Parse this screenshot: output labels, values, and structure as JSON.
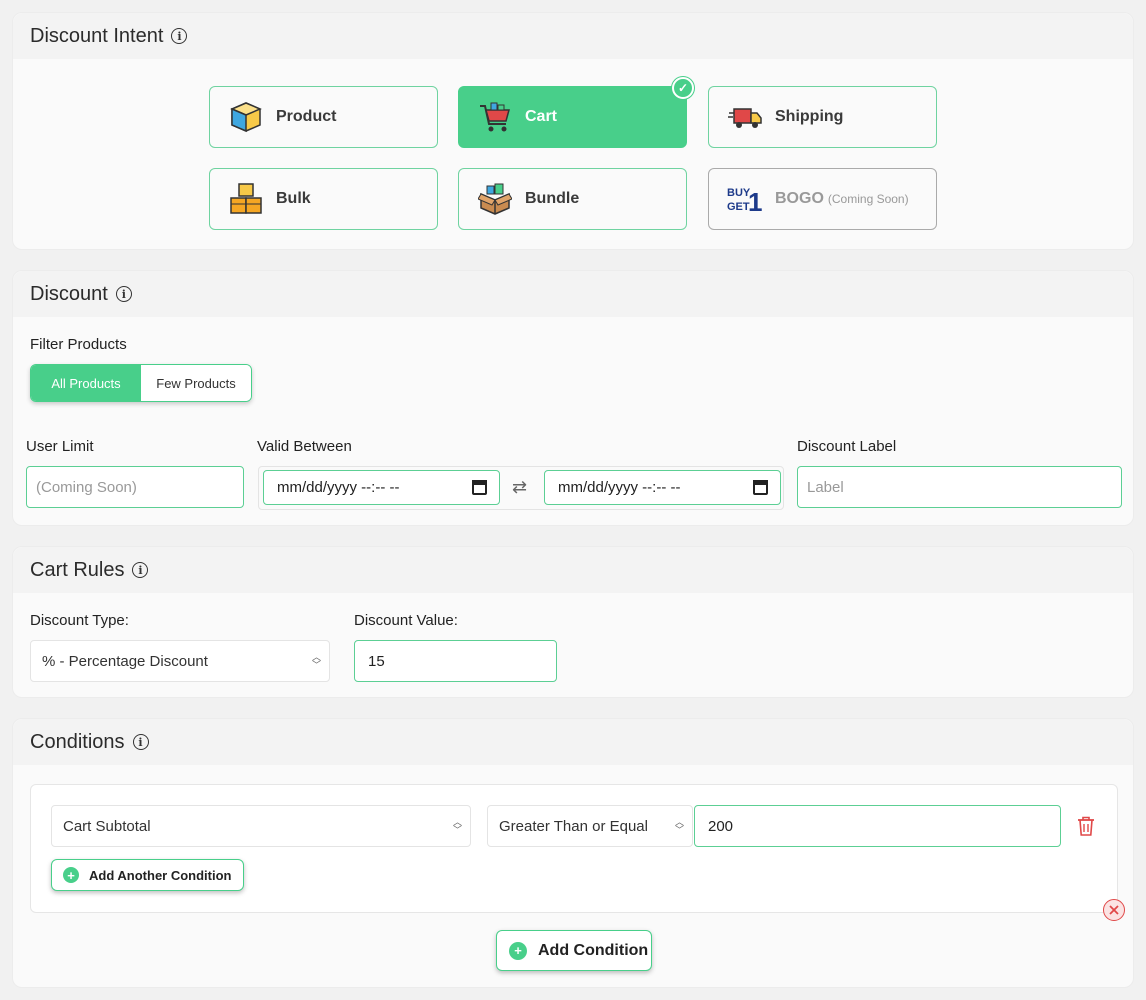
{
  "intent": {
    "title": "Discount Intent",
    "cards": [
      {
        "label": "Product",
        "icon": "product-box-icon"
      },
      {
        "label": "Cart",
        "icon": "shopping-cart-icon",
        "selected": true
      },
      {
        "label": "Shipping",
        "icon": "delivery-truck-icon"
      },
      {
        "label": "Bulk",
        "icon": "stacked-boxes-icon"
      },
      {
        "label": "Bundle",
        "icon": "bundle-box-icon"
      },
      {
        "label": "BOGO",
        "sub": "(Coming Soon)",
        "icon": "buy-get-1-icon",
        "disabled": true
      }
    ]
  },
  "discount": {
    "title": "Discount",
    "filter_label": "Filter Products",
    "filter_options": [
      "All Products",
      "Few Products"
    ],
    "filter_selected": "All Products",
    "user_limit_label": "User Limit",
    "user_limit_placeholder": "(Coming Soon)",
    "valid_between_label": "Valid Between",
    "date_from": "mm/dd/yyyy --:-- --",
    "date_to": "mm/dd/yyyy --:-- --",
    "discount_label_label": "Discount Label",
    "discount_label_placeholder": "Label"
  },
  "cart_rules": {
    "title": "Cart Rules",
    "type_label": "Discount Type:",
    "type_value": "% - Percentage Discount",
    "value_label": "Discount Value:",
    "value": "15"
  },
  "conditions": {
    "title": "Conditions",
    "field": "Cart Subtotal",
    "operator": "Greater Than or Equal",
    "value": "200",
    "add_another_label": "Add Another Condition",
    "add_condition_label": "Add Condition"
  },
  "colors": {
    "accent": "#48cf8a",
    "danger": "#e04848"
  }
}
